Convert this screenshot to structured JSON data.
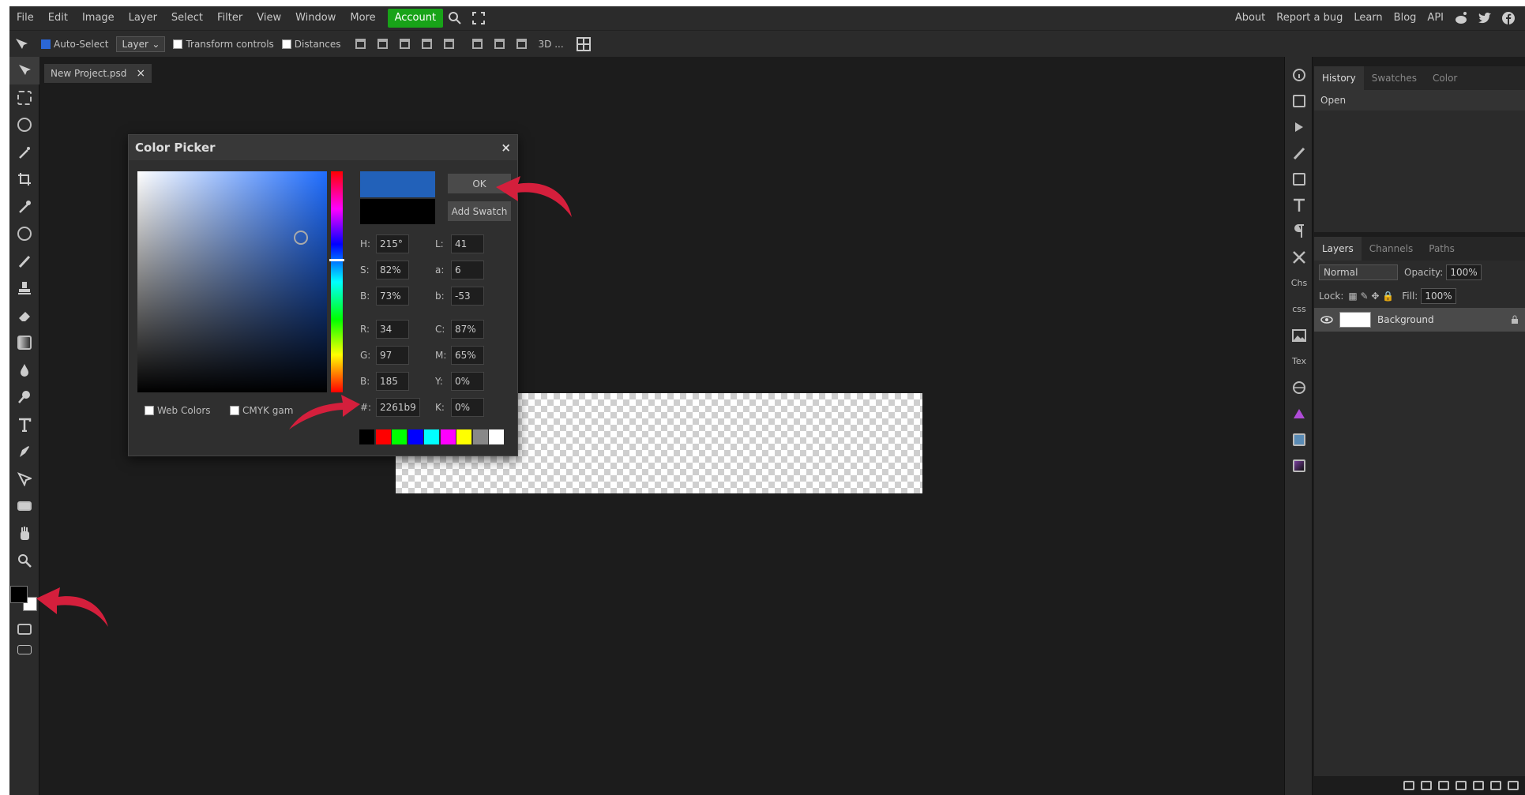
{
  "menubar": {
    "items": [
      "File",
      "Edit",
      "Image",
      "Layer",
      "Select",
      "Filter",
      "View",
      "Window",
      "More"
    ],
    "account": "Account",
    "right_items": [
      "About",
      "Report a bug",
      "Learn",
      "Blog",
      "API"
    ]
  },
  "options": {
    "auto_select": "Auto-Select",
    "layer_select": "Layer",
    "transform_controls": "Transform controls",
    "distances": "Distances",
    "extra": "3D ..."
  },
  "document": {
    "tab_label": "New Project.psd",
    "close": "×"
  },
  "color_picker": {
    "title": "Color Picker",
    "close": "×",
    "ok": "OK",
    "add_swatch": "Add Swatch",
    "new_color": "#2261b9",
    "old_color": "#000000",
    "hsb": [
      {
        "label": "H:",
        "value": "215°"
      },
      {
        "label": "S:",
        "value": "82%"
      },
      {
        "label": "B:",
        "value": "73%"
      }
    ],
    "lab": [
      {
        "label": "L:",
        "value": "41"
      },
      {
        "label": "a:",
        "value": "6"
      },
      {
        "label": "b:",
        "value": "-53"
      }
    ],
    "rgb": [
      {
        "label": "R:",
        "value": "34"
      },
      {
        "label": "G:",
        "value": "97"
      },
      {
        "label": "B:",
        "value": "185"
      }
    ],
    "cmyk": [
      {
        "label": "C:",
        "value": "87%"
      },
      {
        "label": "M:",
        "value": "65%"
      },
      {
        "label": "Y:",
        "value": "0%"
      },
      {
        "label": "K:",
        "value": "0%"
      }
    ],
    "hex_label": "#:",
    "hex_value": "2261b9",
    "web_colors": "Web Colors",
    "cmyk_gamut": "CMYK gam",
    "swatches": [
      "#000000",
      "#ff0000",
      "#00ff00",
      "#0000ff",
      "#00ffff",
      "#ff00ff",
      "#ffff00",
      "#888888",
      "#ffffff"
    ]
  },
  "right_icons": {
    "chs": "Chs",
    "css": "css",
    "tex": "Tex"
  },
  "history_panel": {
    "tabs": [
      "History",
      "Swatches",
      "Color"
    ],
    "items": [
      "Open"
    ]
  },
  "layers_panel": {
    "tabs": [
      "Layers",
      "Channels",
      "Paths"
    ],
    "blend_mode": "Normal",
    "opacity_label": "Opacity:",
    "opacity_value": "100%",
    "lock_label": "Lock:",
    "fill_label": "Fill:",
    "fill_value": "100%",
    "layer_name": "Background"
  },
  "colors": {
    "annotation_arrow": "#d41f3c",
    "account_green": "#18a318",
    "picked_blue": "#2261b9"
  }
}
